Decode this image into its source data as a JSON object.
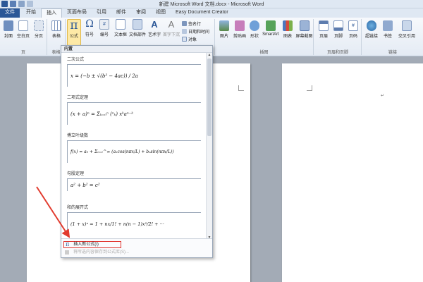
{
  "window": {
    "title": "新建 Microsoft Word 文档.docx - Microsoft Word"
  },
  "tabs": [
    "文件",
    "开始",
    "插入",
    "页面布局",
    "引用",
    "邮件",
    "审阅",
    "视图",
    "Easy Document Creator"
  ],
  "active_tab": "插入",
  "ribbon": {
    "page_group": {
      "label": "页",
      "buttons": [
        "封面",
        "空白页",
        "分页"
      ]
    },
    "table_group": {
      "label": "表格",
      "buttons": [
        "表格"
      ]
    },
    "symbols": {
      "equation": "公式",
      "symbol": "符号",
      "number": "编号"
    },
    "text": {
      "textbox": "文本框",
      "parts": "文档部件",
      "wordart": "艺术字",
      "dropcap": "首字下沉",
      "signature": "签名行",
      "datetime": "日期和时间",
      "object": "对象"
    },
    "illustrations": {
      "label": "插图",
      "buttons": [
        "图片",
        "剪贴画",
        "形状",
        "SmartArt",
        "图表",
        "屏幕截图"
      ]
    },
    "header_footer": {
      "label": "页眉和页脚",
      "buttons": [
        "页眉",
        "页脚",
        "页码"
      ]
    },
    "links": {
      "label": "链接",
      "buttons": [
        "超链接",
        "书签",
        "交叉引用"
      ]
    }
  },
  "dropdown": {
    "header": "内置",
    "items": [
      {
        "name": "二次公式",
        "formula": "x = (−b ± √(b² − 4ac)) / 2a"
      },
      {
        "name": "二项式定理",
        "formula": "(x + a)ⁿ = Σₖ₌₀ⁿ (ⁿₖ) xᵏaⁿ⁻ᵏ"
      },
      {
        "name": "傅立叶级数",
        "formula": "f(x) = a₀ + Σₙ₌₁^∞ (aₙcos(nπx/L) + bₙsin(nπx/L))"
      },
      {
        "name": "勾股定理",
        "formula": "a² + b² = c²"
      },
      {
        "name": "和的展开式",
        "formula": "(1 + x)ⁿ = 1 + nx/1! + n(n − 1)x²/2! + ···"
      }
    ],
    "insert_new": "插入新公式(I)",
    "save_selection": "将所选内容保存到公式库(S)..."
  },
  "colors": {
    "file_tab": "#2b5797",
    "highlight": "#e0302a",
    "arrow": "#e23b2e"
  }
}
